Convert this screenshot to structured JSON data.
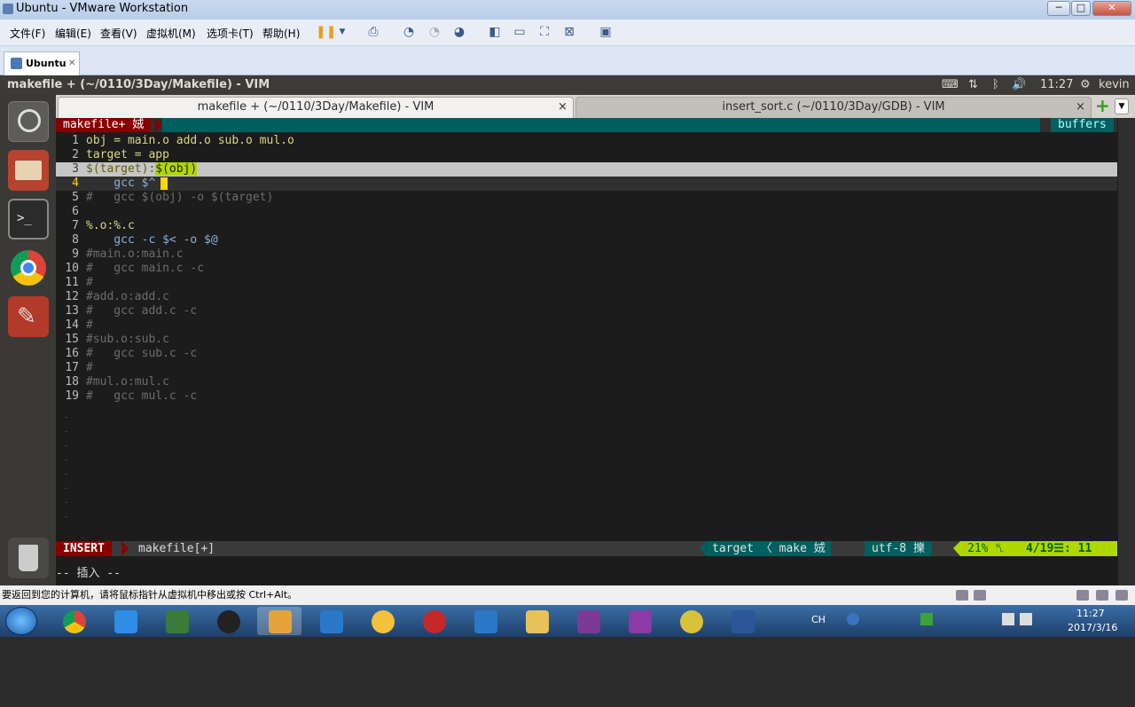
{
  "window": {
    "title": "Ubuntu - VMware Workstation",
    "min": "─",
    "max": "□",
    "close": "✕"
  },
  "menu": [
    "文件(F)",
    "编辑(E)",
    "查看(V)",
    "虚拟机(M)",
    "选项卡(T)",
    "帮助(H)"
  ],
  "vm_tab": {
    "label": "Ubuntu",
    "close": "✕"
  },
  "ubuntu_panel": {
    "title": "makefile + (~/0110/3Day/Makefile) - VIM",
    "time": "11:27",
    "user": "kevin"
  },
  "gvim_tabs": [
    {
      "label": "makefile + (~/0110/3Day/Makefile) - VIM",
      "close": "×"
    },
    {
      "label": "insert_sort.c (~/0110/3Day/GDB) - VIM",
      "close": "×"
    }
  ],
  "vim": {
    "bufferline": "makefile+ 娀",
    "buffers_label": "buffers",
    "lines": [
      {
        "n": "1",
        "text": "obj = main.o add.o sub.o mul.o"
      },
      {
        "n": "2",
        "text": "target = app"
      },
      {
        "n": "3",
        "pre": "$(target):",
        "hl": "$(obj)"
      },
      {
        "n": "4",
        "text": "    gcc $^"
      },
      {
        "n": "5",
        "text": "#   gcc $(obj) -o $(target)"
      },
      {
        "n": "6",
        "text": ""
      },
      {
        "n": "7",
        "text": "%.o:%.c"
      },
      {
        "n": "8",
        "text": "    gcc -c $< -o $@"
      },
      {
        "n": "9",
        "text": "#main.o:main.c"
      },
      {
        "n": "10",
        "text": "#   gcc main.c -c"
      },
      {
        "n": "11",
        "text": "#"
      },
      {
        "n": "12",
        "text": "#add.o:add.c"
      },
      {
        "n": "13",
        "text": "#   gcc add.c -c"
      },
      {
        "n": "14",
        "text": "#"
      },
      {
        "n": "15",
        "text": "#sub.o:sub.c"
      },
      {
        "n": "16",
        "text": "#   gcc sub.c -c"
      },
      {
        "n": "17",
        "text": "#"
      },
      {
        "n": "18",
        "text": "#mul.o:mul.c"
      },
      {
        "n": "19",
        "text": "#   gcc mul.c -c"
      }
    ],
    "status": {
      "mode": "INSERT",
      "file": "makefile[+]",
      "tag": "target 〈 make 娀",
      "enc": "utf-8 擽",
      "pct": "21% ␤",
      "pos": "4/19☰: 11"
    },
    "cmdline": "-- 插入 --"
  },
  "status_hint": "要返回到您的计算机，请将鼠标指针从虚拟机中移出或按 Ctrl+Alt。",
  "taskbar": {
    "time": "11:27",
    "date": "2017/3/16",
    "lang": "CH"
  },
  "colors": {
    "vim_bg": "#1c1c1c",
    "insert_red": "#870000",
    "airline_teal": "#005f5f",
    "buffers_green": "#00af87",
    "accent_lime": "#afd700"
  }
}
